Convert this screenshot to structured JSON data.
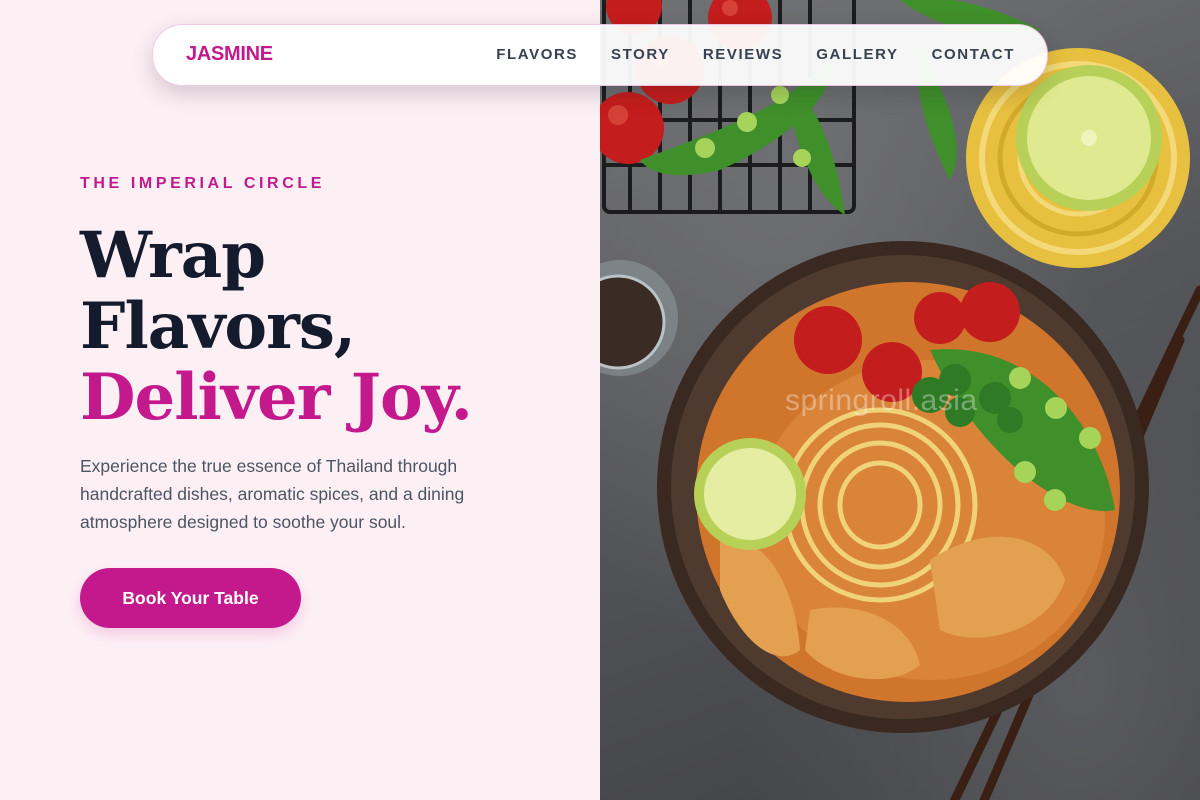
{
  "nav": {
    "brand": "JASMINE",
    "links": [
      "FLAVORS",
      "STORY",
      "REVIEWS",
      "GALLERY",
      "CONTACT"
    ]
  },
  "hero": {
    "eyebrow": "THE IMPERIAL CIRCLE",
    "headline_lines": [
      "Wrap",
      "Flavors,"
    ],
    "headline_accent": "Deliver Joy.",
    "description": "Experience the true essence of Thailand through handcrafted dishes, aromatic spices, and a dining atmosphere designed to soothe your soul.",
    "cta_label": "Book Your Table"
  },
  "image": {
    "subject": "Thai curry noodles in coconut shell bowl",
    "watermark": "springroll.asia"
  },
  "colors": {
    "accent": "#c4198d",
    "heading": "#141b2d",
    "body_text": "#4b5563",
    "left_bg": "#fdf0f5",
    "nav_text": "#374151"
  }
}
